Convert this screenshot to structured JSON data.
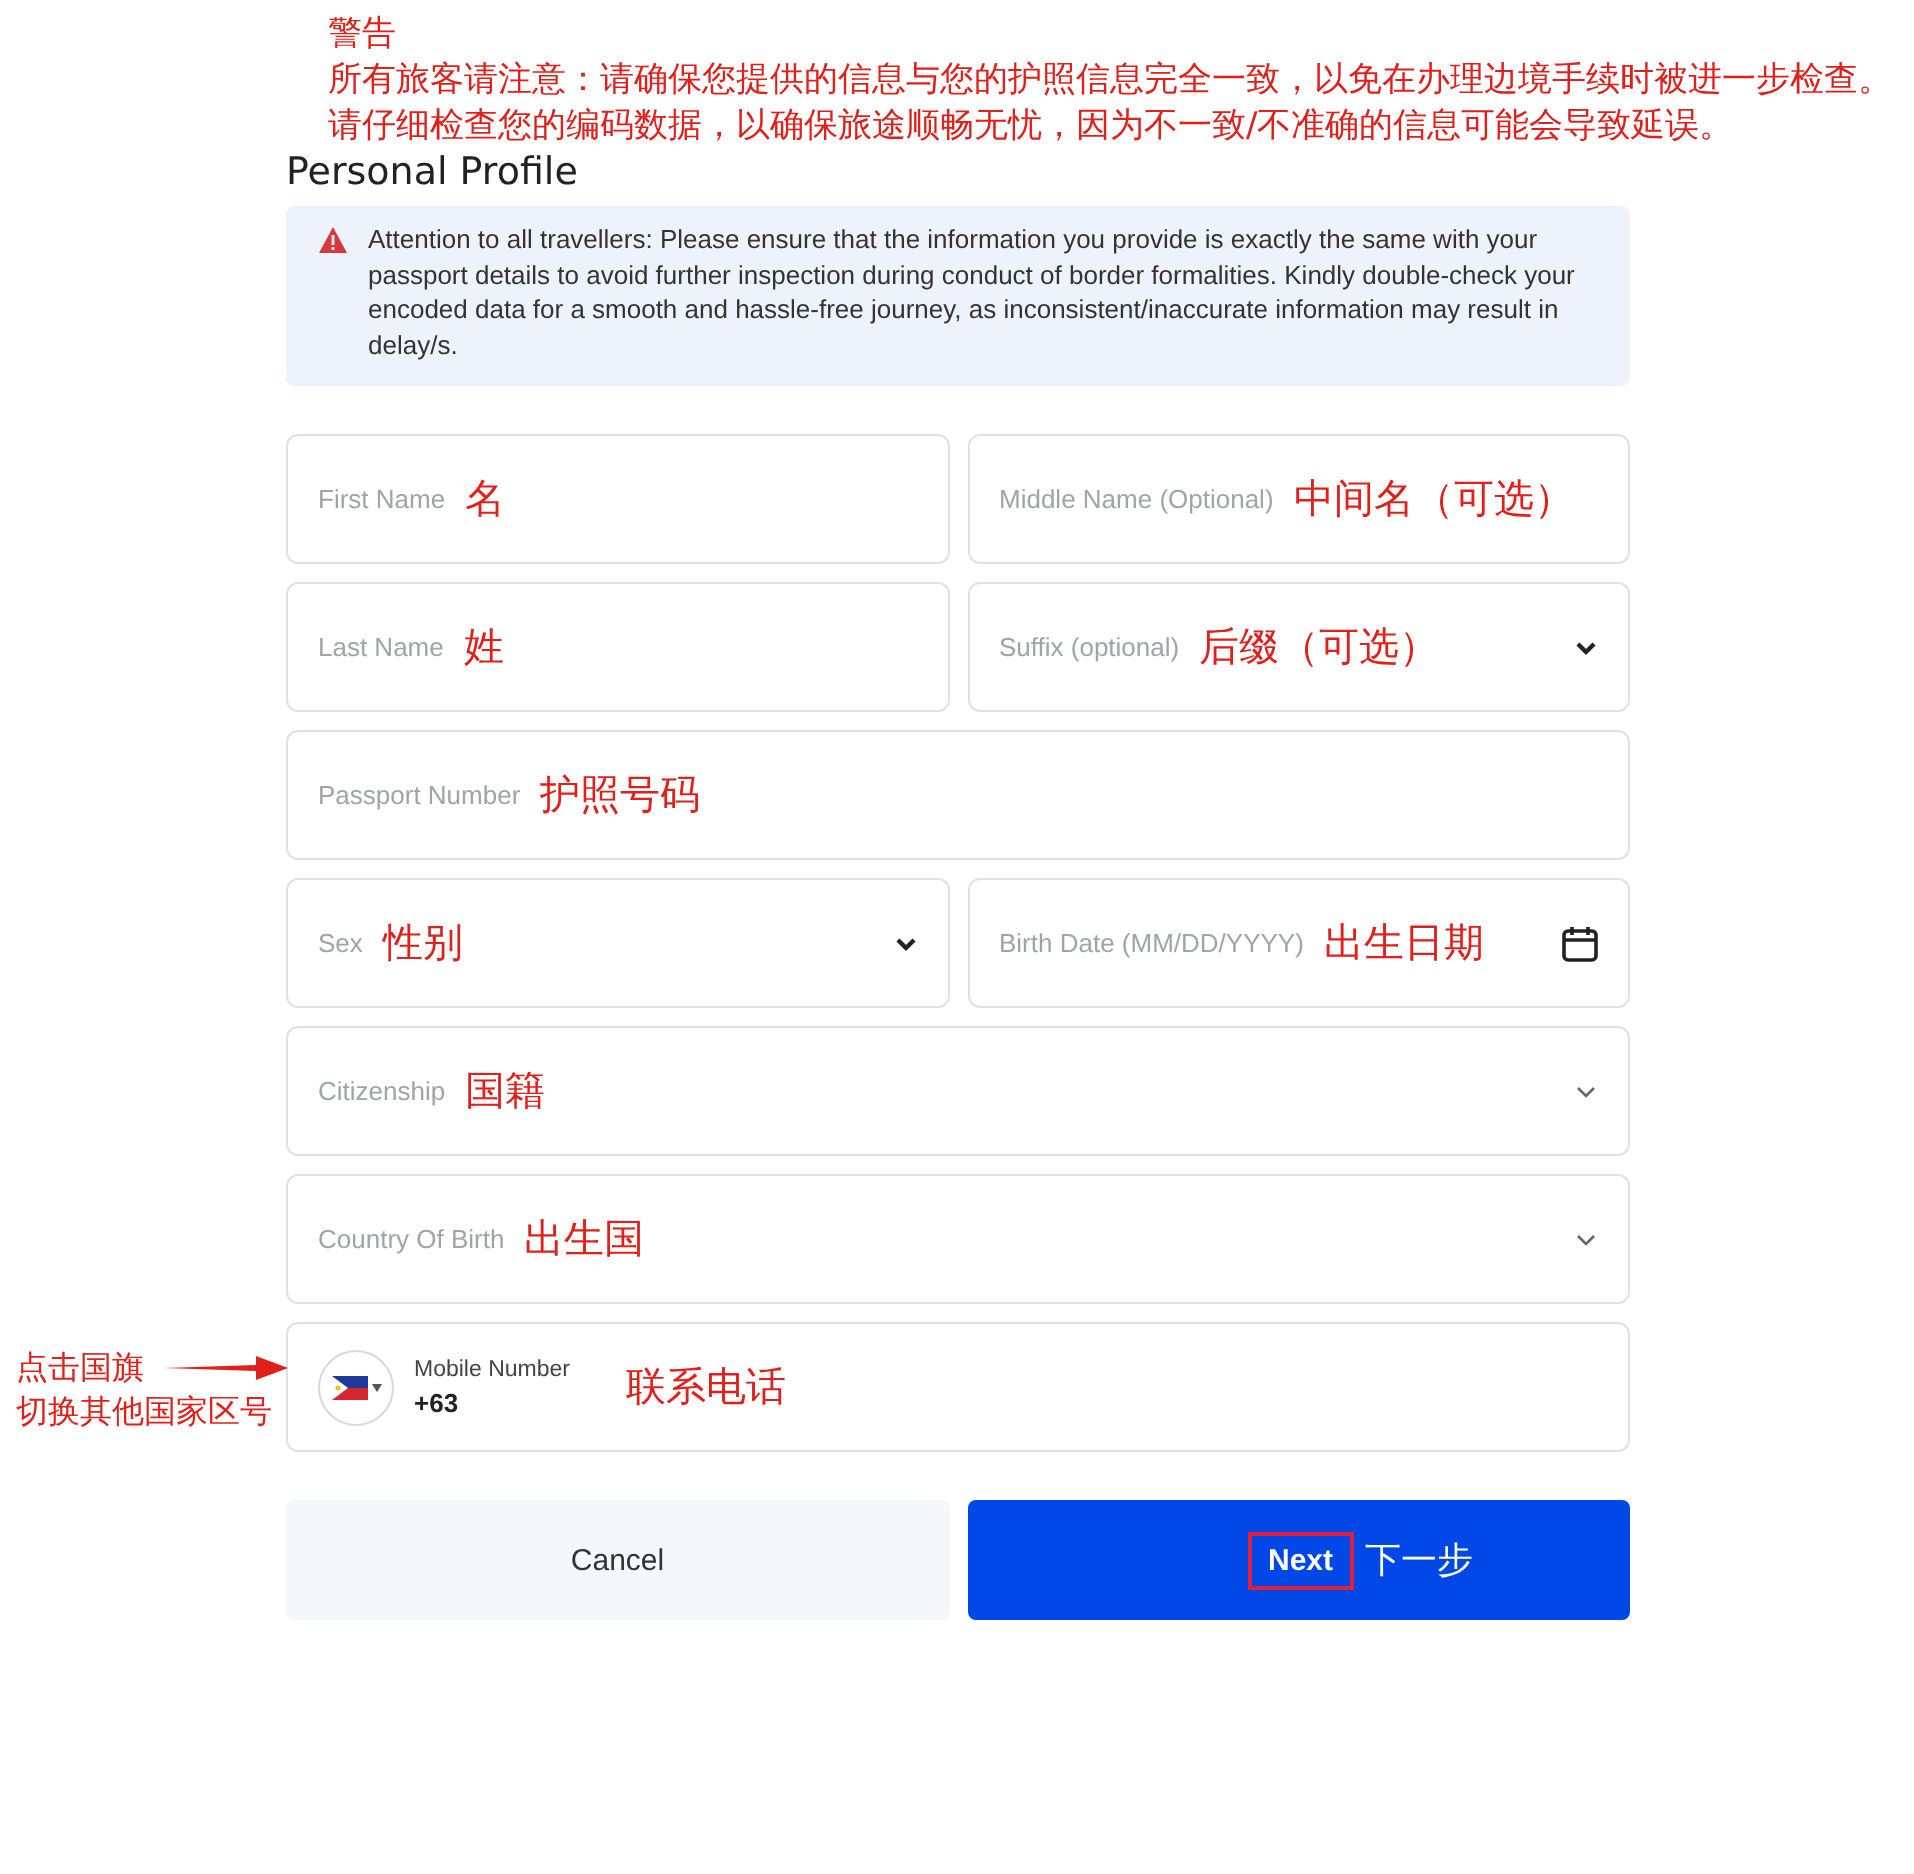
{
  "annotation_title": "警告",
  "annotation_text": "所有旅客请注意：请确保您提供的信息与您的护照信息完全一致，以免在办理边境手续时被进一步检查。请仔细检查您的编码数据，以确保旅途顺畅无忧，因为不一致/不准确的信息可能会导致延误。",
  "title": "Personal Profile",
  "alert": "Attention to all travellers: Please ensure that the information you provide is exactly the same with your passport details to avoid further inspection during conduct of border formalities. Kindly double-check your encoded data for a smooth and hassle-free journey, as inconsistent/inaccurate information may result in delay/s.",
  "rows": [
    [
      {
        "kind": "text",
        "placeholder": "First Name",
        "note": "名"
      },
      {
        "kind": "text",
        "placeholder": "Middle Name (Optional)",
        "note": "中间名（可选）"
      }
    ],
    [
      {
        "kind": "text",
        "placeholder": "Last Name",
        "note": "姓"
      },
      {
        "kind": "dropdown",
        "placeholder": "Suffix (optional)",
        "note": "后缀（可选）"
      }
    ],
    [
      {
        "kind": "text",
        "placeholder": "Passport Number",
        "note": "护照号码"
      }
    ],
    [
      {
        "kind": "dropdown",
        "placeholder": "Sex",
        "note": "性别"
      },
      {
        "kind": "date",
        "placeholder": "Birth Date (MM/DD/YYYY)",
        "note": "出生日期"
      }
    ],
    [
      {
        "kind": "combobox",
        "placeholder": "Citizenship",
        "note": "国籍"
      }
    ],
    [
      {
        "kind": "combobox",
        "placeholder": "Country Of Birth",
        "note": "出生国"
      }
    ],
    [
      {
        "kind": "phone",
        "label": "Mobile Number",
        "value": "+63",
        "note": "联系电话",
        "side_notes": [
          "点击国旗",
          "切换其他国家区号"
        ]
      }
    ]
  ],
  "buttons": [
    {
      "kind": "secondary",
      "label": "Cancel"
    },
    {
      "kind": "primary",
      "label": "Next",
      "note": "下一步"
    }
  ]
}
